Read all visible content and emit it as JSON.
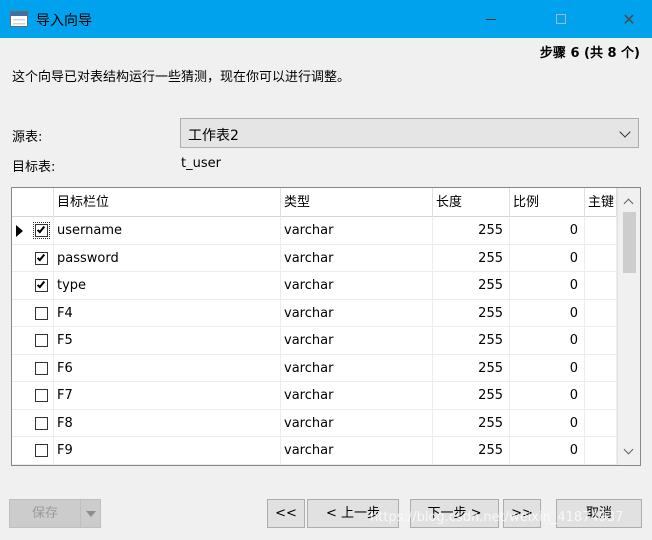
{
  "window": {
    "title": "导入向导"
  },
  "step": "步骤 6 (共 8 个)",
  "description": "这个向导已对表结构运行一些猜测，现在你可以进行调整。",
  "source": {
    "label": "源表:",
    "value": "工作表2"
  },
  "target": {
    "label": "目标表:",
    "value": "t_user"
  },
  "grid": {
    "headers": [
      "目标栏位",
      "类型",
      "长度",
      "比例",
      "主键"
    ],
    "rows": [
      {
        "checked": true,
        "name": "username",
        "type": "varchar",
        "length": "255",
        "scale": "0"
      },
      {
        "checked": true,
        "name": "password",
        "type": "varchar",
        "length": "255",
        "scale": "0"
      },
      {
        "checked": true,
        "name": "type",
        "type": "varchar",
        "length": "255",
        "scale": "0"
      },
      {
        "checked": false,
        "name": "F4",
        "type": "varchar",
        "length": "255",
        "scale": "0"
      },
      {
        "checked": false,
        "name": "F5",
        "type": "varchar",
        "length": "255",
        "scale": "0"
      },
      {
        "checked": false,
        "name": "F6",
        "type": "varchar",
        "length": "255",
        "scale": "0"
      },
      {
        "checked": false,
        "name": "F7",
        "type": "varchar",
        "length": "255",
        "scale": "0"
      },
      {
        "checked": false,
        "name": "F8",
        "type": "varchar",
        "length": "255",
        "scale": "0"
      },
      {
        "checked": false,
        "name": "F9",
        "type": "varchar",
        "length": "255",
        "scale": "0"
      }
    ]
  },
  "buttons": {
    "save": "保存",
    "first": "<<",
    "prev": "< 上一步",
    "next": "下一步 >",
    "last": ">>",
    "cancel": "取消"
  },
  "watermark": "https://blog.csdn.net/weixin_41874937"
}
